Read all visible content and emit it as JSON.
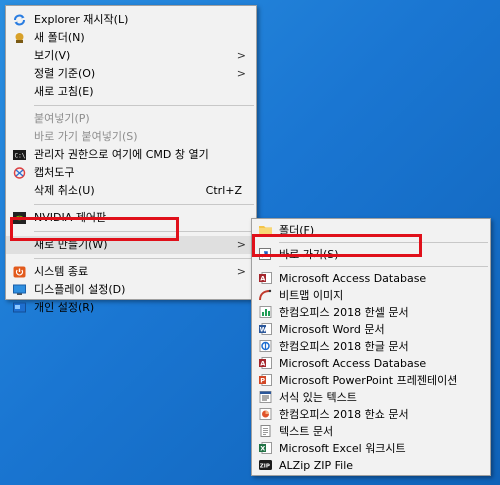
{
  "main_menu": {
    "items": [
      {
        "label": "Explorer 재시작(L)",
        "icon": "refresh-icon",
        "disabled": false
      },
      {
        "label": "새 폴더(N)",
        "icon": "new-folder-icon",
        "disabled": false
      },
      {
        "label": "보기(V)",
        "icon": "",
        "disabled": false,
        "submenu": true
      },
      {
        "label": "정렬 기준(O)",
        "icon": "",
        "disabled": false,
        "submenu": true
      },
      {
        "label": "새로 고침(E)",
        "icon": "",
        "disabled": false
      },
      {
        "label": "붙여넣기(P)",
        "icon": "",
        "disabled": true
      },
      {
        "label": "바로 가기 붙여넣기(S)",
        "icon": "",
        "disabled": true
      },
      {
        "label": "관리자 권한으로 여기에 CMD 창 열기",
        "icon": "cmd-icon",
        "disabled": false
      },
      {
        "label": "캡처도구",
        "icon": "snipping-tool-icon",
        "disabled": false
      },
      {
        "label": "삭제 취소(U)",
        "icon": "",
        "disabled": false,
        "shortcut": "Ctrl+Z"
      },
      {
        "label": "NVIDIA 제어판",
        "icon": "nvidia-icon",
        "disabled": false
      },
      {
        "label": "새로 만들기(W)",
        "icon": "",
        "disabled": false,
        "submenu": true
      },
      {
        "label": "시스템 종료",
        "icon": "shutdown-icon",
        "disabled": false,
        "submenu": true
      },
      {
        "label": "디스플레이 설정(D)",
        "icon": "display-icon",
        "disabled": false
      },
      {
        "label": "개인 설정(R)",
        "icon": "personalize-icon",
        "disabled": false
      }
    ]
  },
  "sub_menu": {
    "items": [
      {
        "label": "폴더(F)",
        "icon": "folder-icon"
      },
      {
        "label": "바로 가기(S)",
        "icon": "shortcut-icon"
      },
      {
        "label": "Microsoft Access Database",
        "icon": "access-icon"
      },
      {
        "label": "비트맵 이미지",
        "icon": "bitmap-icon"
      },
      {
        "label": "한컴오피스 2018 한셀 문서",
        "icon": "hancell-icon"
      },
      {
        "label": "Microsoft Word 문서",
        "icon": "word-icon"
      },
      {
        "label": "한컴오피스 2018 한글 문서",
        "icon": "hwp-icon"
      },
      {
        "label": "Microsoft Access Database",
        "icon": "access-icon"
      },
      {
        "label": "Microsoft PowerPoint 프레젠테이션",
        "icon": "powerpoint-icon"
      },
      {
        "label": "서식 있는 텍스트",
        "icon": "rtf-icon"
      },
      {
        "label": "한컴오피스 2018 한쇼 문서",
        "icon": "hanshow-icon"
      },
      {
        "label": "텍스트 문서",
        "icon": "text-doc-icon"
      },
      {
        "label": "Microsoft Excel 워크시트",
        "icon": "excel-icon"
      },
      {
        "label": "ALZip ZIP File",
        "icon": "alzip-icon"
      }
    ]
  },
  "colors": {
    "highlight_box": "#e0101a",
    "desktop": "#1a76d2"
  }
}
